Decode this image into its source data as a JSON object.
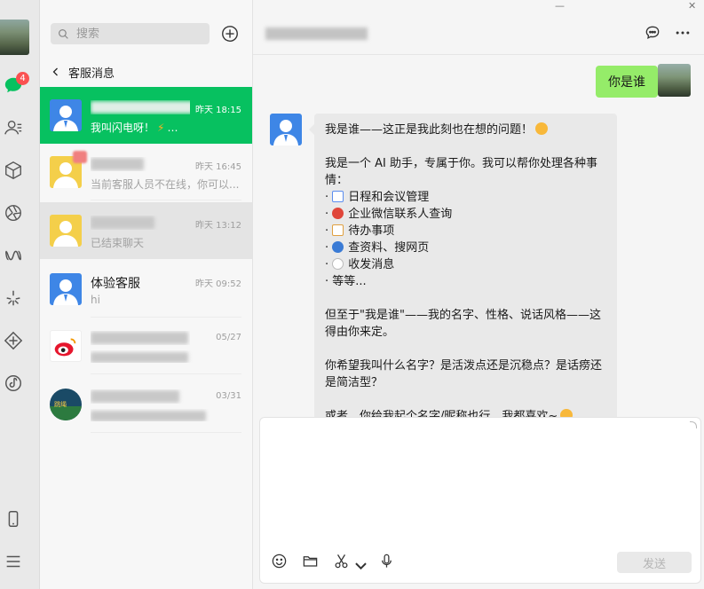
{
  "nav": {
    "chat_badge": "4",
    "icons": [
      "chat-icon",
      "contacts-icon",
      "cube-icon",
      "aperture-icon",
      "miniprogram-icon",
      "sparkle-icon",
      "diamond-icon",
      "music-icon",
      "phone-icon",
      "menu-icon"
    ],
    "accent": "#07c160"
  },
  "list": {
    "search_placeholder": "搜索",
    "back_label": "客服消息",
    "items": [
      {
        "name": "",
        "time": "昨天 18:15",
        "preview": "我叫闪电呀！",
        "preview_suffix": "…"
      },
      {
        "name": "",
        "time": "昨天 16:45",
        "preview": "当前客服人员不在线，你可以..."
      },
      {
        "name": "",
        "time": "昨天 13:12",
        "preview": "已结束聊天"
      },
      {
        "name": "体验客服",
        "time": "昨天 09:52",
        "preview": "hi"
      },
      {
        "name": "",
        "time": "05/27",
        "preview": ""
      },
      {
        "name": "",
        "time": "03/31",
        "preview": ""
      }
    ]
  },
  "chat": {
    "title": "",
    "my_message": "你是谁",
    "bot_message": {
      "line1": "我是谁——这正是我此刻也在想的问题！",
      "line2": "我是一个 AI 助手，专属于你。我可以帮你处理各种事情：",
      "bullets": [
        "日程和会议管理",
        "企业微信联系人查询",
        "待办事项",
        "查资料、搜网页",
        "收发消息"
      ],
      "etc": "· 等等...",
      "para3": "但至于\"我是谁\"——我的名字、性格、说话风格——这得由你来定。",
      "para4": "你希望我叫什么名字？是活泼点还是沉稳点？是话痨还是简洁型？",
      "para5": "或者，你给我起个名字/昵称也行，我都喜欢~"
    },
    "send_label": "发送"
  },
  "window": {
    "minimize": "—",
    "close": "✕"
  }
}
